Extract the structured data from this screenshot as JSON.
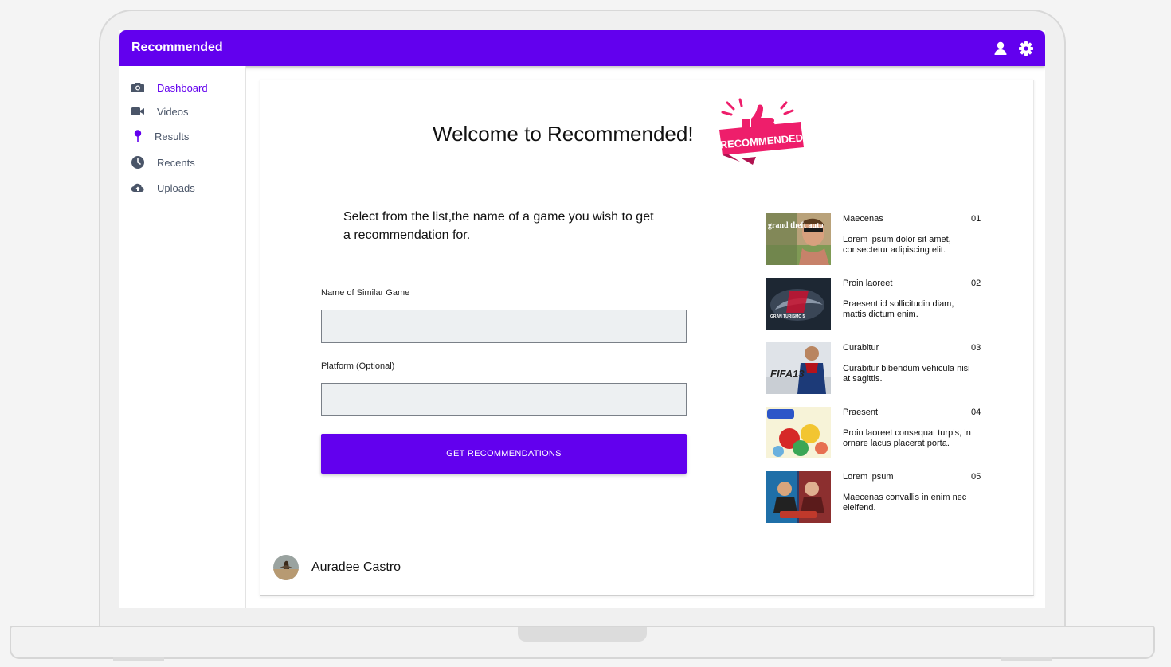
{
  "app": {
    "title": "Recommended",
    "accent_color": "#6200ee",
    "appbar_icons": [
      "user-icon",
      "gear-icon"
    ]
  },
  "sidebar": {
    "items": [
      {
        "label": "Dashboard",
        "icon": "camera-icon",
        "active": true
      },
      {
        "label": "Videos",
        "icon": "video-camera-icon",
        "active": false
      },
      {
        "label": "Results",
        "icon": "map-pin-icon",
        "active": false
      },
      {
        "label": "Recents",
        "icon": "clock-icon",
        "active": false
      },
      {
        "label": "Uploads",
        "icon": "cloud-upload-icon",
        "active": false
      }
    ]
  },
  "main": {
    "welcome": "Welcome to Recommended!",
    "badge_text": "RECOMMENDED",
    "instructions": "Select from the list,the name of a game you wish to get a recommendation for.",
    "form": {
      "game_label": "Name of Similar Game",
      "game_value": "",
      "platform_label": "Platform (Optional)",
      "platform_value": "",
      "submit_label": "GET RECOMMENDATIONS"
    },
    "recommendations": [
      {
        "title": "Maecenas",
        "number": "01",
        "description": "Lorem ipsum dolor sit amet, consectetur adipiscing elit.",
        "thumb_text": "grand theft auto"
      },
      {
        "title": "Proin laoreet",
        "number": "02",
        "description": "Praesent id sollicitudin diam, mattis dictum enim.",
        "thumb_text": "GRAN TURISMO 5"
      },
      {
        "title": "Curabitur",
        "number": "03",
        "description": "Curabitur bibendum vehicula nisi at sagittis.",
        "thumb_text": "FIFA13"
      },
      {
        "title": "Praesent",
        "number": "04",
        "description": "Proin laoreet consequat turpis, in ornare lacus placerat porta.",
        "thumb_text": ""
      },
      {
        "title": "Lorem ipsum",
        "number": "05",
        "description": "Maecenas convallis in enim nec eleifend.",
        "thumb_text": ""
      }
    ]
  },
  "footer": {
    "user_name": "Auradee Castro"
  }
}
